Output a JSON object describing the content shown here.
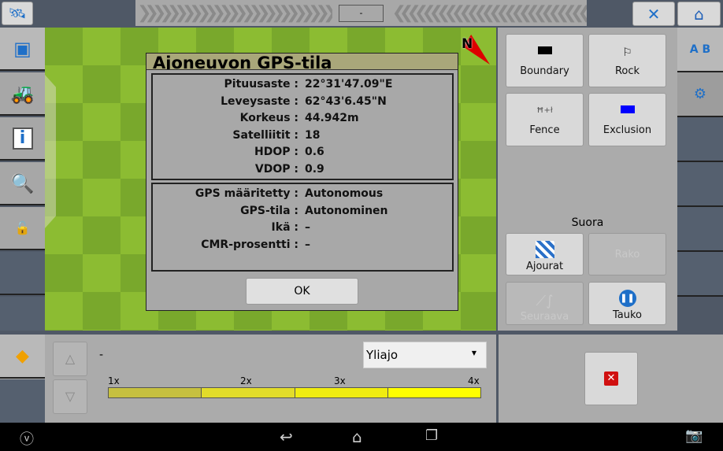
{
  "topbar": {
    "center_value": "-",
    "icons": [
      "satellite-icon",
      "tools-icon",
      "home-icon"
    ]
  },
  "left_tabs": [
    "tractor-top-icon",
    "tractor-icon",
    "info-icon",
    "zoom-icon",
    "unlock-icon"
  ],
  "compass": {
    "label": "N"
  },
  "dialog": {
    "title": "Ajoneuvon GPS-tila",
    "position": [
      {
        "label": "Pituusaste :",
        "value": "22°31'47.09\"E"
      },
      {
        "label": "Leveysaste :",
        "value": "62°43'6.45\"N"
      },
      {
        "label": "Korkeus :",
        "value": "44.942m"
      },
      {
        "label": "Satelliitit :",
        "value": "18"
      },
      {
        "label": "HDOP :",
        "value": "0.6"
      },
      {
        "label": "VDOP :",
        "value": "0.9"
      }
    ],
    "status": [
      {
        "label": "GPS määritetty :",
        "value": "Autonomous"
      },
      {
        "label": "GPS-tila :",
        "value": "Autonominen"
      },
      {
        "label": "Ikä :",
        "value": "–"
      },
      {
        "label": "CMR-prosentti :",
        "value": "–"
      }
    ],
    "ok_label": "OK"
  },
  "right_panel": {
    "boundary": "Boundary",
    "rock": "Rock",
    "fence": "Fence",
    "exclusion": "Exclusion",
    "section_title": "Suora",
    "ajourat": "Ajourat",
    "rako": "Rako",
    "seuraava": "Seuraava",
    "tauko": "Tauko"
  },
  "bottom": {
    "value": "-",
    "dropdown": "Yliajo",
    "scale": [
      "1x",
      "2x",
      "3x",
      "4x"
    ],
    "scale_colors": [
      "#c6c040",
      "#e2dc2a",
      "#f0ec10",
      "#ffff00"
    ]
  }
}
